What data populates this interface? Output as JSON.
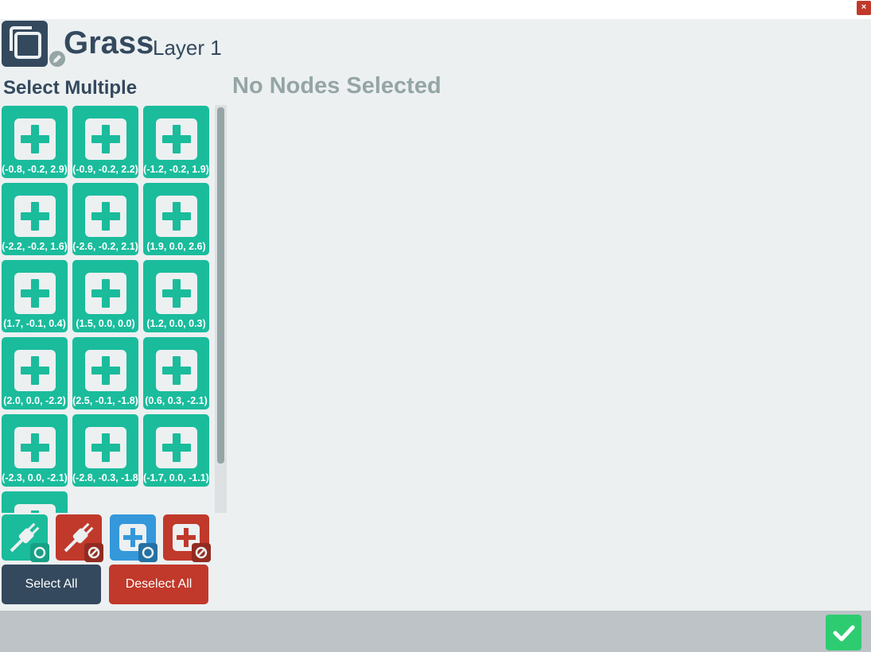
{
  "window": {
    "close_label": "×"
  },
  "header": {
    "title": "Grass",
    "subtitle": "Layer 1",
    "icon": "copy-layers-icon",
    "edit_icon": "pencil-icon"
  },
  "selection": {
    "heading": "Select Multiple",
    "status": "No Nodes Selected"
  },
  "nodes": [
    {
      "label": "(-0.8, -0.2, 2.9)"
    },
    {
      "label": "(-0.9, -0.2, 2.2)"
    },
    {
      "label": "(-1.2, -0.2, 1.9)"
    },
    {
      "label": "(-2.2, -0.2, 1.6)"
    },
    {
      "label": "(-2.6, -0.2, 2.1)"
    },
    {
      "label": "(1.9, 0.0, 2.6)"
    },
    {
      "label": "(1.7, -0.1, 0.4)"
    },
    {
      "label": "(1.5, 0.0, 0.0)"
    },
    {
      "label": "(1.2, 0.0, 0.3)"
    },
    {
      "label": "(2.0, 0.0, -2.2)"
    },
    {
      "label": "(2.5, -0.1, -1.8)"
    },
    {
      "label": "(0.6, 0.3, -2.1)"
    },
    {
      "label": "(-2.3, 0.0, -2.1)"
    },
    {
      "label": "(-2.8, -0.3, -1.8)"
    },
    {
      "label": "(-1.7, 0.0, -1.1)"
    },
    {
      "label": ""
    }
  ],
  "actions": {
    "connect_all": "plug-circle-icon",
    "disconnect_all": "plug-ban-icon",
    "add_all": "plus-circle-icon",
    "remove_all": "plus-ban-icon",
    "select_all_label": "Select All",
    "deselect_all_label": "Deselect All"
  },
  "colors": {
    "teal": "#1abc9c",
    "red": "#c0392b",
    "blue": "#3498db",
    "navy": "#34495e",
    "green": "#2ecc71"
  }
}
